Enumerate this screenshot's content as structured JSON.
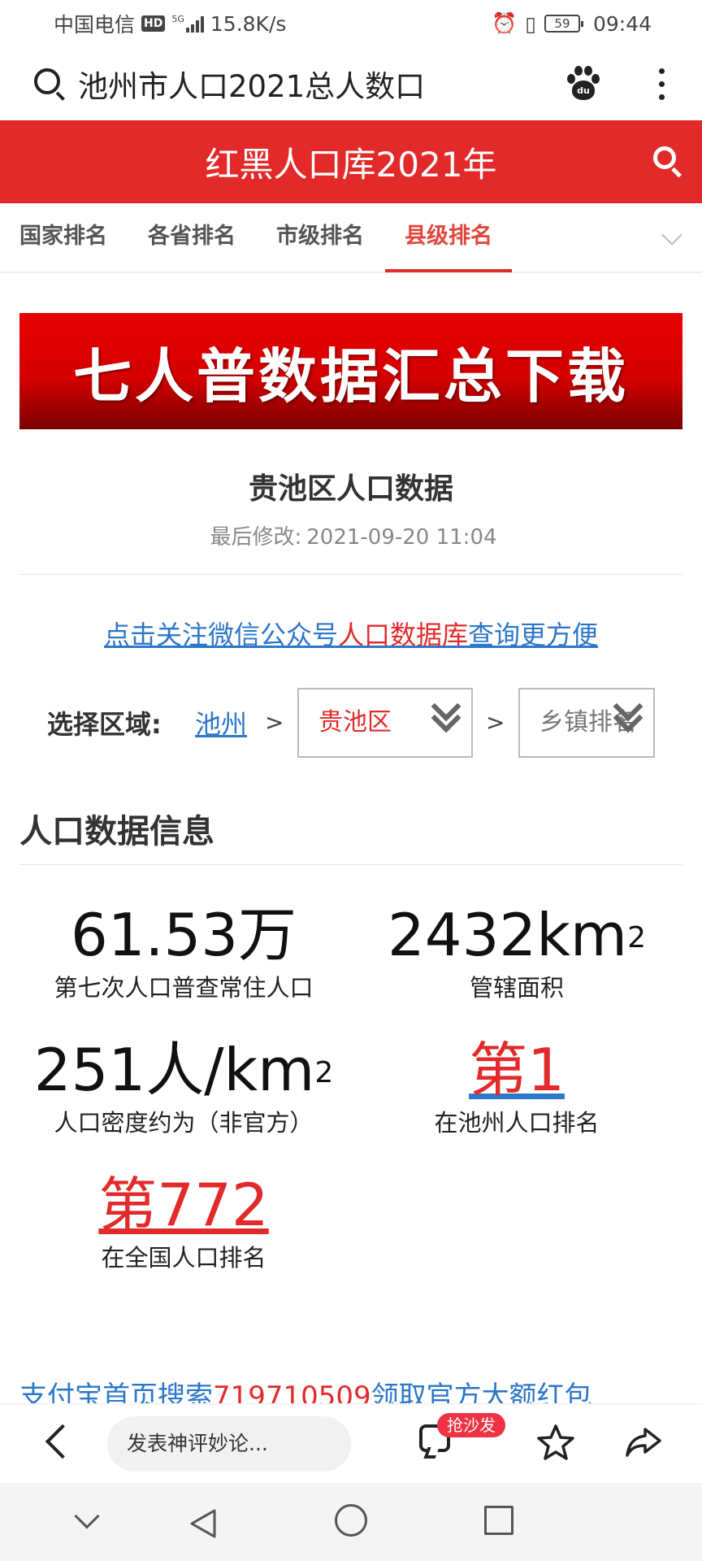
{
  "status_bar": {
    "carrier": "中国电信",
    "hd": "HD",
    "net_type": "5G",
    "speed": "15.8K/s",
    "battery": "59",
    "time": "09:44"
  },
  "search_bar": {
    "query": "池州市人口2021总人数口"
  },
  "header": {
    "title": "红黑人口库2021年"
  },
  "tabs": [
    {
      "label": "国家排名",
      "active": false
    },
    {
      "label": "各省排名",
      "active": false
    },
    {
      "label": "市级排名",
      "active": false
    },
    {
      "label": "县级排名",
      "active": true
    }
  ],
  "banner": {
    "text": "七人普数据汇总下载"
  },
  "article": {
    "title": "贵池区人口数据",
    "modified_label": "最后修改:",
    "modified_time": "2021-09-20 11:04"
  },
  "follow_link": {
    "prefix": "点击关注微信公众号",
    "highlight": "人口数据库",
    "suffix": "查询更方便"
  },
  "region": {
    "label": "选择区域:",
    "city": "池州",
    "sep": ">",
    "district": "贵池区",
    "town_placeholder": "乡镇排名"
  },
  "section": {
    "title": "人口数据信息"
  },
  "stats": {
    "population": {
      "value": "61.53万",
      "label": "第七次人口普查常住人口"
    },
    "area": {
      "value": "2432km",
      "sup": "2",
      "label": "管辖面积"
    },
    "density": {
      "value": "251人/km",
      "sup": "2",
      "label": "人口密度约为（非官方）"
    },
    "city_rank": {
      "value": "第1",
      "label": "在池州人口排名"
    },
    "national_rank": {
      "value": "第772",
      "label": "在全国人口排名"
    }
  },
  "promo": {
    "prefix": "支付宝首页搜索",
    "code": "719710509",
    "suffix": "领取官方大额红包"
  },
  "action_bar": {
    "comment_placeholder": "发表神评妙论...",
    "badge": "抢沙发"
  }
}
